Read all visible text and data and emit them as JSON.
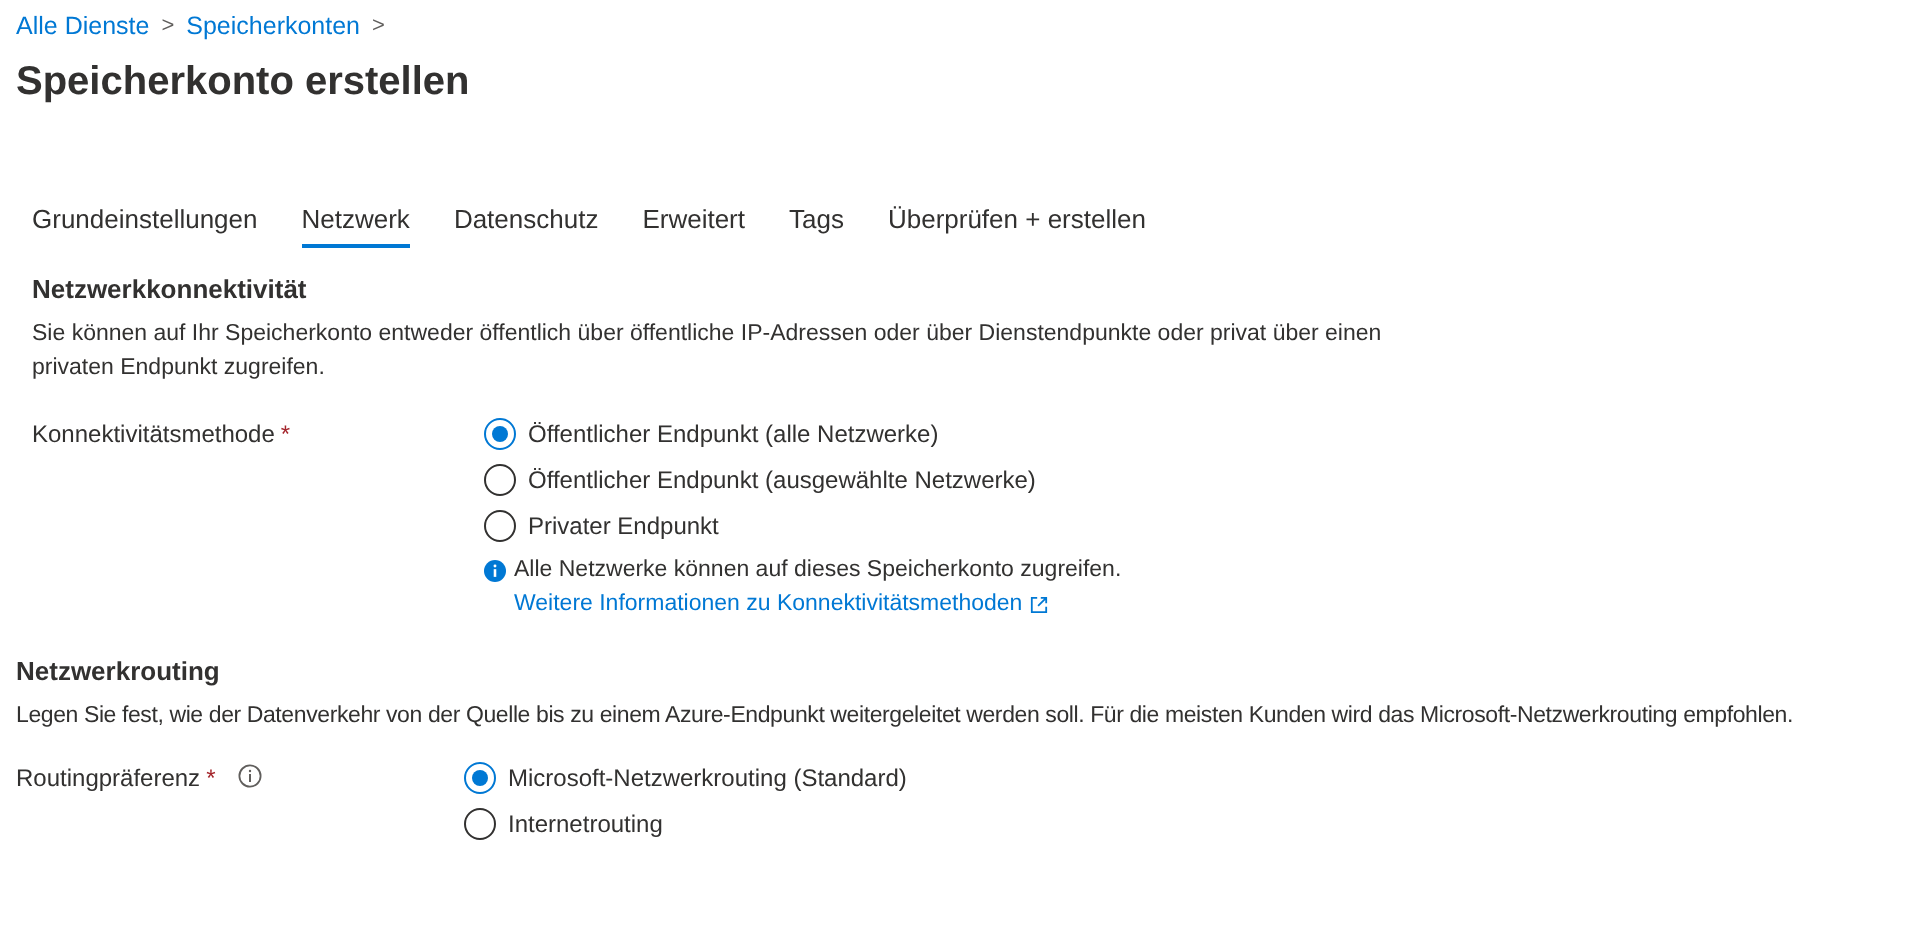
{
  "breadcrumb": [
    {
      "label": "Alle Dienste",
      "separator": ">"
    },
    {
      "label": "Speicherkonten",
      "separator": ">"
    }
  ],
  "title": "Speicherkonto erstellen",
  "tabs": [
    {
      "label": "Grundeinstellungen",
      "selected": false
    },
    {
      "label": "Netzwerk",
      "selected": true
    },
    {
      "label": "Datenschutz",
      "selected": false
    },
    {
      "label": "Erweitert",
      "selected": false
    },
    {
      "label": "Tags",
      "selected": false
    },
    {
      "label": "Überprüfen + erstellen",
      "selected": false
    }
  ],
  "sections": [
    {
      "heading": "Netzwerkkonnektivität",
      "description": "Sie können auf Ihr Speicherkonto entweder öffentlich über öffentliche IP-Adressen oder über Dienstendpunkte oder privat über einen privaten Endpunkt zugreifen.",
      "field": {
        "label": "Konnektivitätsmethode",
        "required_mark": "*",
        "info_icon": false,
        "options": [
          {
            "label": "Öffentlicher Endpunkt (alle Netzwerke)",
            "selected": true
          },
          {
            "label": "Öffentlicher Endpunkt (ausgewählte Netzwerke)",
            "selected": false
          },
          {
            "label": "Privater Endpunkt",
            "selected": false
          }
        ],
        "note": "Alle Netzwerke können auf dieses Speicherkonto zugreifen.",
        "link": "Weitere Informationen zu Konnektivitätsmethoden"
      }
    },
    {
      "heading": "Netzwerkrouting",
      "description": "Legen Sie fest, wie der Datenverkehr von der Quelle bis zu einem Azure-Endpunkt weitergeleitet werden soll. Für die meisten Kunden wird das Microsoft-Netzwerkrouting empfohlen.",
      "field": {
        "label": "Routingpräferenz",
        "required_mark": "*",
        "info_icon": true,
        "options": [
          {
            "label": "Microsoft-Netzwerkrouting (Standard)",
            "selected": true
          },
          {
            "label": "Internetrouting",
            "selected": false
          }
        ]
      }
    }
  ]
}
